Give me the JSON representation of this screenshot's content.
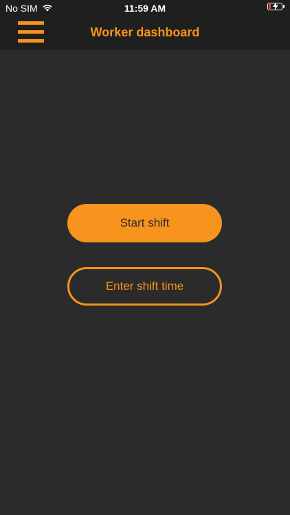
{
  "status_bar": {
    "carrier": "No SIM",
    "time": "11:59 AM",
    "battery_color": "#ff3b30"
  },
  "nav": {
    "title": "Worker dashboard",
    "menu_icon": "hamburger-menu-icon"
  },
  "actions": {
    "start_shift_label": "Start shift",
    "enter_shift_time_label": "Enter shift time"
  },
  "colors": {
    "accent": "#f7941d",
    "background": "#2b2b2b",
    "bar_background": "#1f1f1f"
  }
}
